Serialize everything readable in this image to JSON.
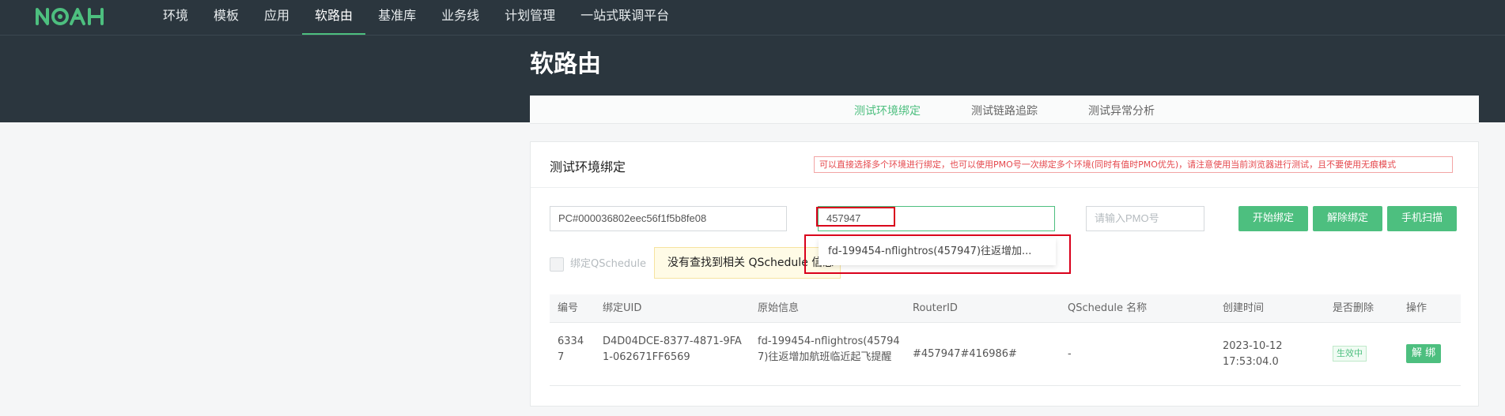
{
  "brand": {
    "logo": "NOAH",
    "accent": "#4dbf7f",
    "dark_bg": "#2b363e"
  },
  "nav": {
    "items": [
      {
        "label": "环境"
      },
      {
        "label": "模板"
      },
      {
        "label": "应用"
      },
      {
        "label": "软路由",
        "active": true
      },
      {
        "label": "基准库"
      },
      {
        "label": "业务线"
      },
      {
        "label": "计划管理"
      },
      {
        "label": "一站式联调平台"
      }
    ]
  },
  "page": {
    "title": "软路由"
  },
  "subnav": {
    "items": [
      {
        "label": "测试环境绑定",
        "active": true
      },
      {
        "label": "测试链路追踪"
      },
      {
        "label": "测试异常分析"
      }
    ]
  },
  "card": {
    "title": "测试环境绑定",
    "notice": "可以直接选择多个环境进行绑定，也可以使用PMO号一次绑定多个环境(同时有值时PMO优先)，请注意使用当前浏览器进行测试，且不要使用无痕模式"
  },
  "form": {
    "uid_value": "PC#000036802eec56f1f5b8fe08",
    "search_value": "457947",
    "pmo_placeholder": "请输入PMO号",
    "bind_button": "开始绑定",
    "unbind_button": "解除绑定",
    "scan_button": "手机扫描",
    "schedule_checkbox_label": "绑定QSchedule",
    "schedule_checked": false,
    "tooltip": "没有查找到相关 QSchedule 信息",
    "suggestion": "fd-199454-nflightros(457947)往返增加..."
  },
  "table": {
    "headers": [
      "编号",
      "绑定UID",
      "原始信息",
      "RouterID",
      "QSchedule 名称",
      "创建时间",
      "是否删除",
      "操作"
    ],
    "rows": [
      {
        "id": "63347",
        "uid": "D4D04DCE-8377-4871-9FA1-062671FF6569",
        "origin": "fd-199454-nflightros(457947)往返增加航班临近起飞提醒",
        "router_id": "#457947#416986#",
        "qschedule": "-",
        "created": "2023-10-12 17:53:04.0",
        "status": "生效中",
        "action": "解 绑"
      }
    ]
  }
}
